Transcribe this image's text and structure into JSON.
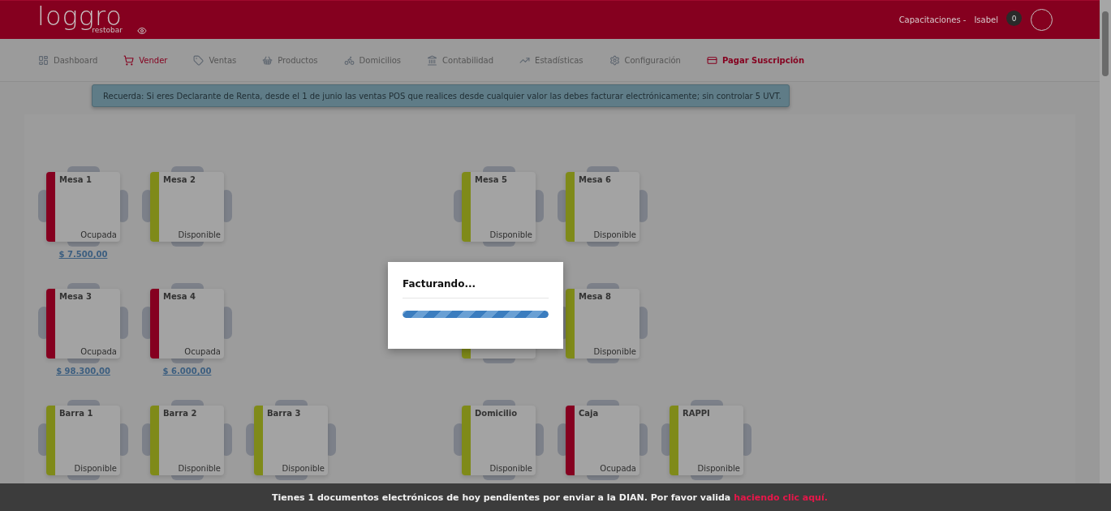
{
  "header": {
    "logo": "loggro",
    "logo_sub": "restobar",
    "company": "Capacitaciones -",
    "user": "Isabel",
    "notifications": "0"
  },
  "nav": [
    {
      "label": "Dashboard",
      "selected": false
    },
    {
      "label": "Vender",
      "selected": true
    },
    {
      "label": "Ventas",
      "selected": false
    },
    {
      "label": "Productos",
      "selected": false
    },
    {
      "label": "Domicilios",
      "selected": false
    },
    {
      "label": "Contabilidad",
      "selected": false
    },
    {
      "label": "Estadísticas",
      "selected": false
    },
    {
      "label": "Configuración",
      "selected": false
    }
  ],
  "subscription_link": {
    "label": "Pagar Suscripción"
  },
  "alert": {
    "text": "Recuerda: Si eres Declarante de Renta, desde el 1 de junio las ventas POS que realices desde cualquier valor las debes facturar electrónicamente; sin controlar 5 UVT."
  },
  "rows": [
    {
      "slots": [
        {
          "kind": "table",
          "name": "Mesa 1",
          "status": "Ocupada",
          "color": "#850020",
          "amount": "$ 7.500,00"
        },
        {
          "kind": "table",
          "name": "Mesa 2",
          "status": "Disponible",
          "color": "#7f8a19"
        },
        {
          "kind": "empty"
        },
        {
          "kind": "empty"
        },
        {
          "kind": "table",
          "name": "Mesa 5",
          "status": "Disponible",
          "color": "#7f8a19"
        },
        {
          "kind": "table",
          "name": "Mesa 6",
          "status": "Disponible",
          "color": "#7f8a19"
        }
      ]
    },
    {
      "slots": [
        {
          "kind": "table",
          "name": "Mesa 3",
          "status": "Ocupada",
          "color": "#850020",
          "amount": "$ 98.300,00"
        },
        {
          "kind": "table",
          "name": "Mesa 4",
          "status": "Ocupada",
          "color": "#850020",
          "amount": "$ 6.000,00"
        },
        {
          "kind": "empty"
        },
        {
          "kind": "empty"
        },
        {
          "kind": "hidden",
          "color": "#7f8a19"
        },
        {
          "kind": "table",
          "name": "Mesa 8",
          "status": "Disponible",
          "color": "#7f8a19"
        }
      ]
    },
    {
      "slots": [
        {
          "kind": "table",
          "name": "Barra 1",
          "status": "Disponible",
          "color": "#7f8a19"
        },
        {
          "kind": "table",
          "name": "Barra 2",
          "status": "Disponible",
          "color": "#7f8a19"
        },
        {
          "kind": "table",
          "name": "Barra 3",
          "status": "Disponible",
          "color": "#7f8a19"
        },
        {
          "kind": "empty"
        },
        {
          "kind": "table",
          "name": "Domicilio",
          "status": "Disponible",
          "color": "#7f8a19"
        },
        {
          "kind": "table",
          "name": "Caja",
          "status": "Ocupada",
          "color": "#850020"
        },
        {
          "kind": "table",
          "name": "RAPPI",
          "status": "Disponible",
          "color": "#7f8a19"
        }
      ]
    }
  ],
  "modal": {
    "title": "Facturando...",
    "level": 1
  },
  "footer": {
    "text": "Tienes 1 documentos electrónicos de hoy pendientes por enviar a la DIAN. Por favor valida",
    "link": "haciendo clic aquí."
  }
}
